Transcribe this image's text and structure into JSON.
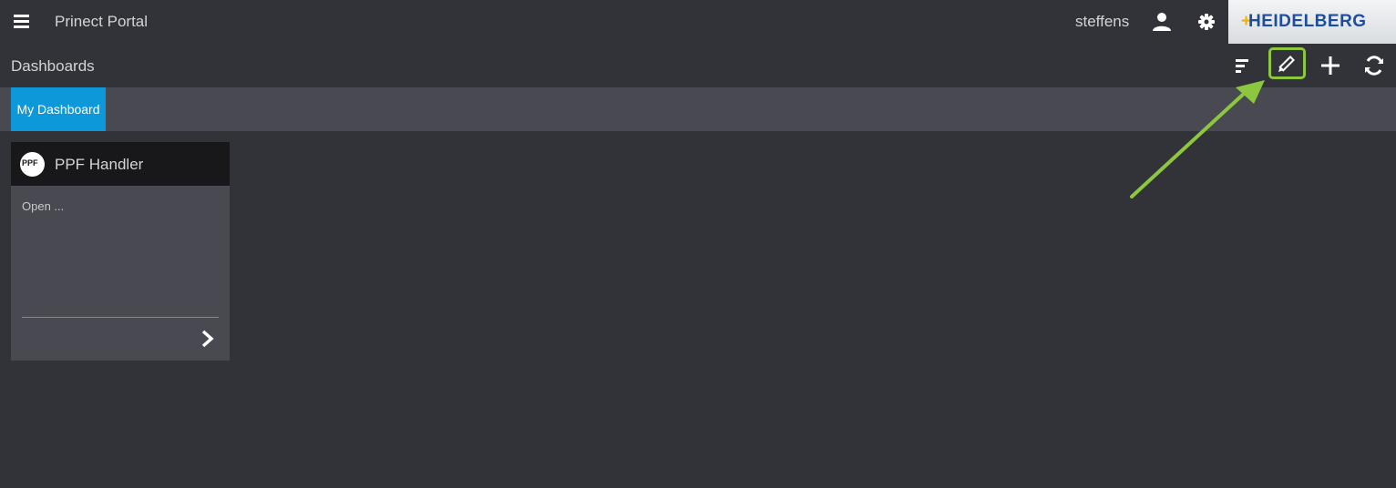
{
  "header": {
    "app_title": "Prinect Portal",
    "username": "steffens",
    "brand_logo": "HEIDELBERG",
    "icons": {
      "menu": "hamburger-menu-icon",
      "user": "user-icon",
      "settings": "gear-icon"
    }
  },
  "toolbar": {
    "page_title": "Dashboards",
    "icons": {
      "sort": "sort-icon",
      "edit": "pencil-icon",
      "add": "plus-icon",
      "refresh": "refresh-icon"
    }
  },
  "tabs": [
    {
      "label": "My Dashboard",
      "active": true
    }
  ],
  "widgets": [
    {
      "title": "PPF Handler",
      "icon_label": "PPF",
      "body_text": "Open ...",
      "icon": "chevron-right-icon"
    }
  ],
  "colors": {
    "background": "#323338",
    "tabbar": "#484951",
    "active_tab": "#0d98d9",
    "highlight": "#8dc63f",
    "brand_blue": "#1d4e9e"
  }
}
